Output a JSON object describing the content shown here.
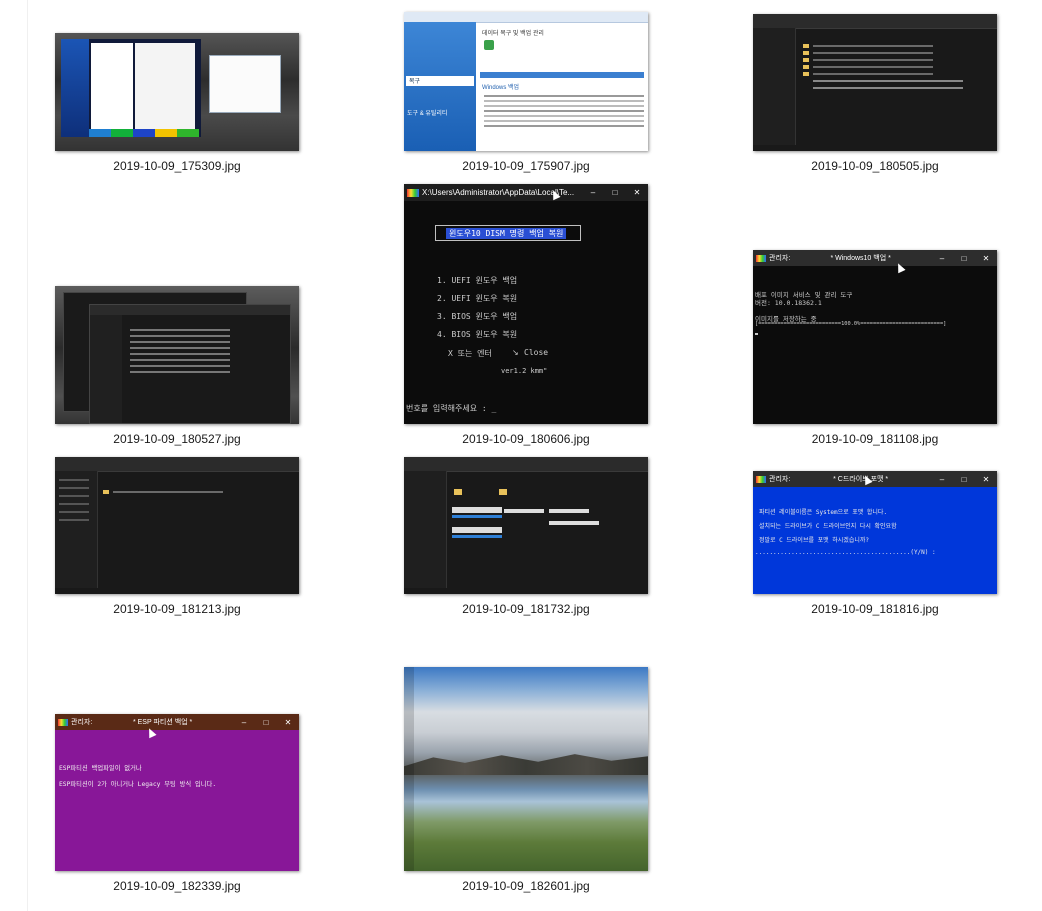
{
  "files": [
    {
      "name": "2019-10-09_175309.jpg"
    },
    {
      "name": "2019-10-09_175907.jpg"
    },
    {
      "name": "2019-10-09_180505.jpg"
    },
    {
      "name": "2019-10-09_180527.jpg"
    },
    {
      "name": "2019-10-09_180606.jpg"
    },
    {
      "name": "2019-10-09_181108.jpg"
    },
    {
      "name": "2019-10-09_181213.jpg"
    },
    {
      "name": "2019-10-09_181732.jpg"
    },
    {
      "name": "2019-10-09_181816.jpg"
    },
    {
      "name": "2019-10-09_182339.jpg"
    },
    {
      "name": "2019-10-09_182601.jpg"
    }
  ],
  "thumb_175907": {
    "title": "데이터 복구 및 백업 관리",
    "tab": "복구",
    "tool": "도구 & 유틸리티",
    "section": "Windows 백업"
  },
  "thumb_180606": {
    "title": "X:\\Users\\Administrator\\AppData\\Local\\Te...",
    "header": "윈도우10 DISM 명령 백업 복원",
    "items": [
      "1. UEFI 윈도우 백업",
      "2. UEFI 윈도우 복원",
      "3. BIOS 윈도우 백업",
      "4. BIOS 윈도우 복원"
    ],
    "exit": "X 또는 엔터",
    "close": "Close",
    "version": "ver1.2 kmm\"",
    "prompt": "번호를 입력해주세요 : _"
  },
  "thumb_181108": {
    "admin": "관리자:",
    "title": "* Windows10 백업 *",
    "line1": "배포 이미지 서비스 및 관리 도구",
    "line2": "버전: 10.0.18362.1",
    "line3": "이미지를 저장하는 중",
    "progress_text": "[==========================100.0%==========================]",
    "progress": 100
  },
  "thumb_181816": {
    "admin": "관리자:",
    "title": "* C드라이브 포맷 *",
    "line1": "파티션 레이블이름은 System으로 포맷 합니다.",
    "line2": "설치되는 드라이브가 C 드라이브인지 다시 확인요함",
    "line3": "정말로 C 드라이브를 포맷 하시겠습니까?",
    "prompt": "...........................................(Y/N) :",
    "bg": "#0037da"
  },
  "thumb_182339": {
    "admin": "관리자:",
    "title": "* ESP 파티션 백업 *",
    "line1": "ESP파티션 백업파일이 없거나",
    "line2": "ESP파티션이 2가 아니거나 Legacy 부팅 방식 입니다.",
    "bg": "#881798"
  }
}
